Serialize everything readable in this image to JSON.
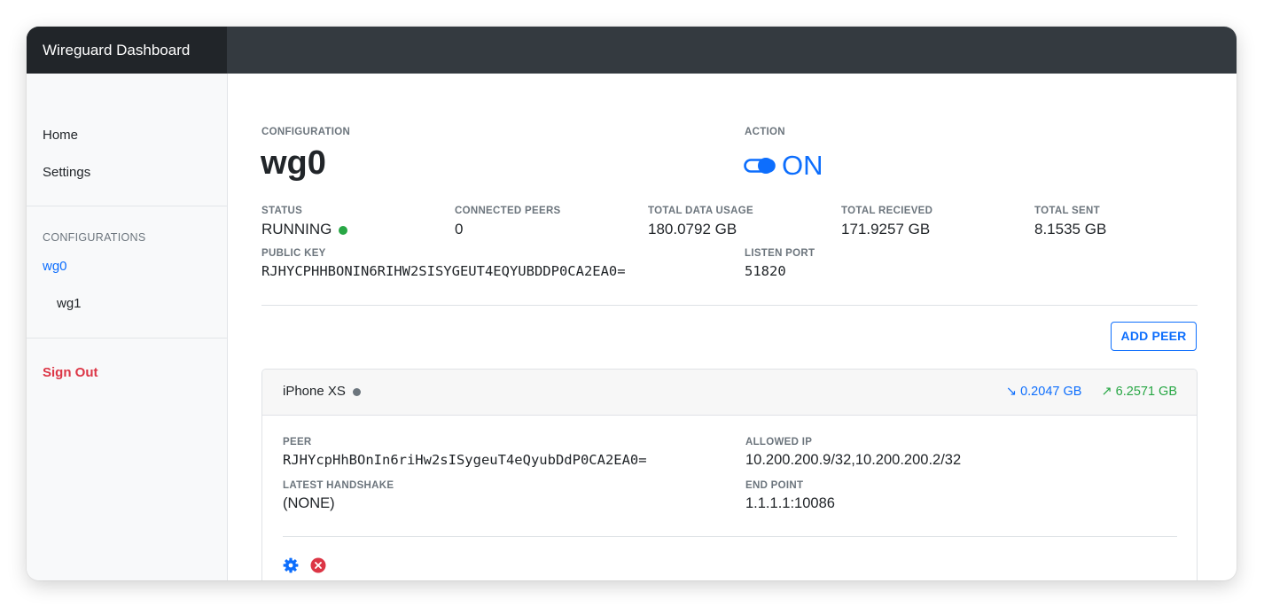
{
  "app": {
    "title": "Wireguard Dashboard"
  },
  "sidebar": {
    "nav": [
      {
        "label": "Home"
      },
      {
        "label": "Settings"
      }
    ],
    "configurations_heading": "CONFIGURATIONS",
    "configs": [
      {
        "label": "wg0",
        "active": true
      },
      {
        "label": "wg1",
        "active": false
      }
    ],
    "sign_out": "Sign Out"
  },
  "config": {
    "configuration_label": "CONFIGURATION",
    "name": "wg0",
    "action_label": "ACTION",
    "toggle_state": "ON",
    "status_label": "STATUS",
    "status_value": "RUNNING",
    "connected_peers_label": "CONNECTED PEERS",
    "connected_peers_value": "0",
    "total_usage_label": "TOTAL DATA USAGE",
    "total_usage_value": "180.0792 GB",
    "total_received_label": "TOTAL RECIEVED",
    "total_received_value": "171.9257 GB",
    "total_sent_label": "TOTAL SENT",
    "total_sent_value": "8.1535 GB",
    "public_key_label": "PUBLIC KEY",
    "public_key_value": "RJHYCPHHBONIN6RIHW2SISYGEUT4EQYUBDDP0CA2EA0=",
    "listen_port_label": "LISTEN PORT",
    "listen_port_value": "51820"
  },
  "add_peer_label": "ADD PEER",
  "peer": {
    "name": "iPhone XS",
    "download": "0.2047 GB",
    "upload": "6.2571 GB",
    "peer_label": "PEER",
    "peer_value": "RJHYcpHhBOnIn6riHw2sISygeuT4eQyubDdP0CA2EA0=",
    "allowed_ip_label": "ALLOWED IP",
    "allowed_ip_value": "10.200.200.9/32,10.200.200.2/32",
    "handshake_label": "LATEST HANDSHAKE",
    "handshake_value": "(NONE)",
    "endpoint_label": "END POINT",
    "endpoint_value": "1.1.1.1:10086"
  },
  "colors": {
    "accent": "#0d6efd",
    "running": "#28a745",
    "danger": "#dc3545",
    "idle": "#6c757d",
    "topbar": "#343a40"
  }
}
